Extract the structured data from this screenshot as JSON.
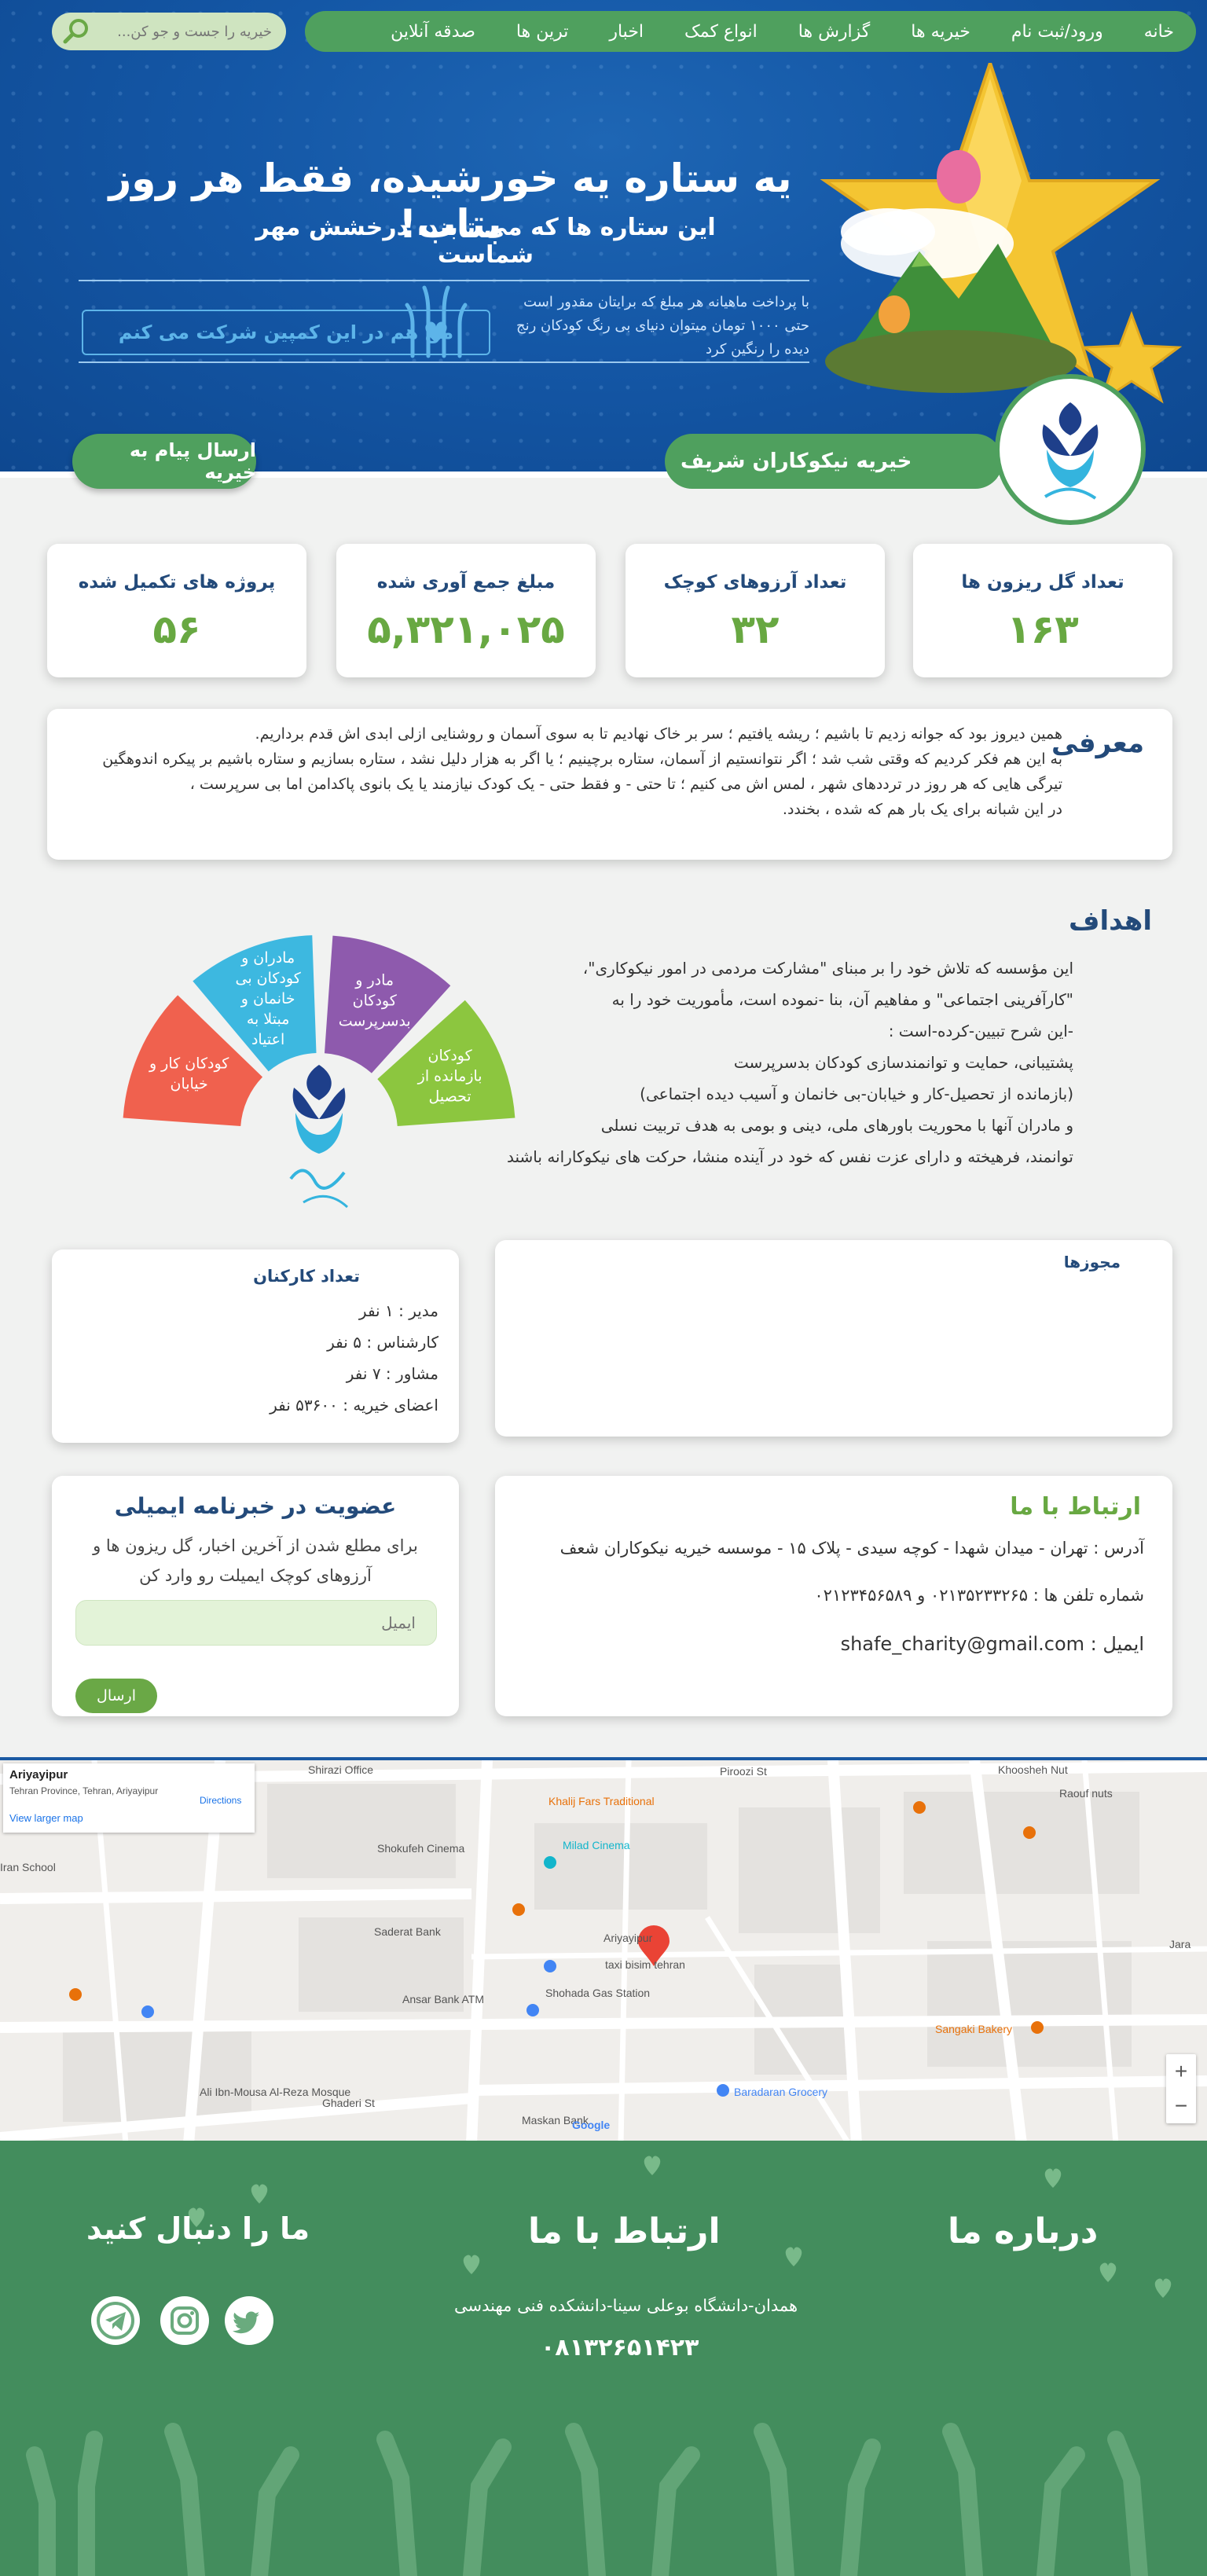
{
  "nav": {
    "items": [
      "خانه",
      "ورود/ثبت نام",
      "خیریه ها",
      "گزارش ها",
      "انواع کمک",
      "اخبار",
      "ترین ها",
      "صدقه آنلاین"
    ],
    "search_placeholder": "خیریه را جست و جو کن..."
  },
  "hero": {
    "headline": "یه ستاره یه خورشیده، فقط هر روز بتاب!",
    "subline": "این ستاره ها که می تابند، درخشش مهر شماست",
    "campaign_text": "با پرداخت ماهیانه هر مبلغ که برایتان مقدور است حتی ۱۰۰۰ تومان میتوان دنیای بی رنگ کودکان رنج دیده را رنگین کرد",
    "campaign_button": "من هم در این کمپین شرکت می کنم"
  },
  "org": {
    "name": "خیریه نیکوکاران شریف",
    "send_message": "ارسال پیام به خیریه"
  },
  "stats": [
    {
      "label": "تعداد گل ریزون ها",
      "value": "۱۶۳"
    },
    {
      "label": "تعداد آرزوهای کوچک",
      "value": "۳۲"
    },
    {
      "label": "مبلغ جمع آوری شده",
      "value": "۵,۳۲۱,۰۲۵"
    },
    {
      "label": "پروژه های تکمیل شده",
      "value": "۵۶"
    }
  ],
  "intro": {
    "title": "معرفی",
    "lines": [
      "همین دیروز بود که جوانه زدیم تا باشیم ؛ ریشه یافتیم ؛ سر بر خاک نهادیم تا به سوی آسمان و روشنایی ازلی ابدی اش قدم برداریم.",
      "به این هم فکر کردیم که وقتی شب شد ؛ اگر نتوانستیم از آسمان، ستاره برچینیم ؛ یا اگر به هزار دلیل نشد ، ستاره بسازیم و ستاره باشیم بر پیکره اندوهگین",
      "تیرگی هایی که هر روز در ترددهای شهر ، لمس اش می کنیم ؛ تا حتی - و فقط حتی - یک کودک نیازمند یا یک بانوی پاکدامن اما بی سرپرست ،",
      "در این شبانه برای یک بار هم که شده ، بخندد."
    ]
  },
  "goals": {
    "title": "اهداف",
    "lines": [
      "این مؤسسه که تلاش خود را بر مبنای  \"مشارکت مردمی در امور نیکوکاری\"،",
      " \"کارآفرینی اجتماعی\" و مفاهیم آن،  بنا -نموده است، مأموریت خود را به",
      "-این شرح تبیین-کرده-است :",
      "پشتیبانی، حمایت و توانمندسازی کودکان بدسرپرست",
      "(بازمانده از تحصیل-کار و خیابان-بی خانمان و آسیب دیده اجتماعی)",
      "و مادران آنها با محوریت باورهای ملی، دینی و بومی به هدف تربیت نسلی",
      "توانمند، فرهیخته و دارای عزت نفس که خود در آینده منشا، حرکت های نیکوکارانه باشند"
    ],
    "segments": [
      {
        "label": "کودکان کار و خیابان",
        "color": "#f0614e"
      },
      {
        "label": "مادران و کودکان بی خانمان و مبتلا به اعتیاد",
        "color": "#3db8e0"
      },
      {
        "label": "مادر و کودکان بدسرپرست",
        "color": "#8e5aad"
      },
      {
        "label": "کودکان بازمانده از تحصیل",
        "color": "#8cc63f"
      }
    ]
  },
  "permits": {
    "title": "مجوزها"
  },
  "staff": {
    "title": "تعداد کارکنان",
    "items": [
      "مدیر : ۱ نفر",
      "کارشناس : ۵ نفر",
      "مشاور : ۷ نفر",
      "اعضای خیریه : ۵۳۶۰۰ نفر"
    ]
  },
  "newsletter": {
    "title": "عضویت در خبرنامه ایمیلی",
    "text": "برای مطلع شدن از آخرین اخبار، گل ریزون ها و آرزوهای کوچک ایمیلت رو وارد کن",
    "placeholder": "ایمیل",
    "button": "ارسال"
  },
  "contact": {
    "title": "ارتباط با ما",
    "address": "آدرس : تهران - میدان شهدا - کوچه سیدی - پلاک ۱۵ - موسسه خیریه نیکوکاران شعف",
    "phones": "شماره تلفن ها : ۰۲۱۳۵۲۳۳۲۶۵  و  ۰۲۱۲۳۴۵۶۵۸۹",
    "email": "ایمیل : shafe_charity@gmail.com"
  },
  "map": {
    "place": "Ariyayipur",
    "address": "Tehran Province, Tehran, Ariyayipur",
    "larger_map": "View larger map",
    "directions": "Directions",
    "labels": [
      "Shirazi Office",
      "Piroozi St",
      "Khoosheh Nut",
      "Raouf nuts",
      "Khalij Fars Traditional",
      "Milad Cinema",
      "Shokufeh Cinema",
      "Saderat Bank",
      "Ariyayipur",
      "taxi bisim tehran",
      "Shohada Gas Station",
      "Ansar Bank ATM",
      "Baradaran Grocery",
      "Sangaki Bakery",
      "Ali Ibn-Mousa Al-Reza Mosque",
      "Maskan Bank",
      "Ghaderi St",
      "Iran School",
      "Jara",
      "Google"
    ],
    "zoom_in": "+",
    "zoom_out": "−"
  },
  "footer": {
    "follow_title": "ما را دنبال کنید",
    "contact_title": "ارتباط با ما",
    "contact_address": "همدان-دانشگاه بوعلی سینا-دانشکده فنی مهندسی",
    "contact_phone": "۰۸۱۳۲۶۵۱۴۲۳",
    "about_title": "درباره ما"
  },
  "colors": {
    "green": "#4fa05e",
    "navy": "#234a7a",
    "accent": "#68a842",
    "footer": "#438d5d"
  }
}
